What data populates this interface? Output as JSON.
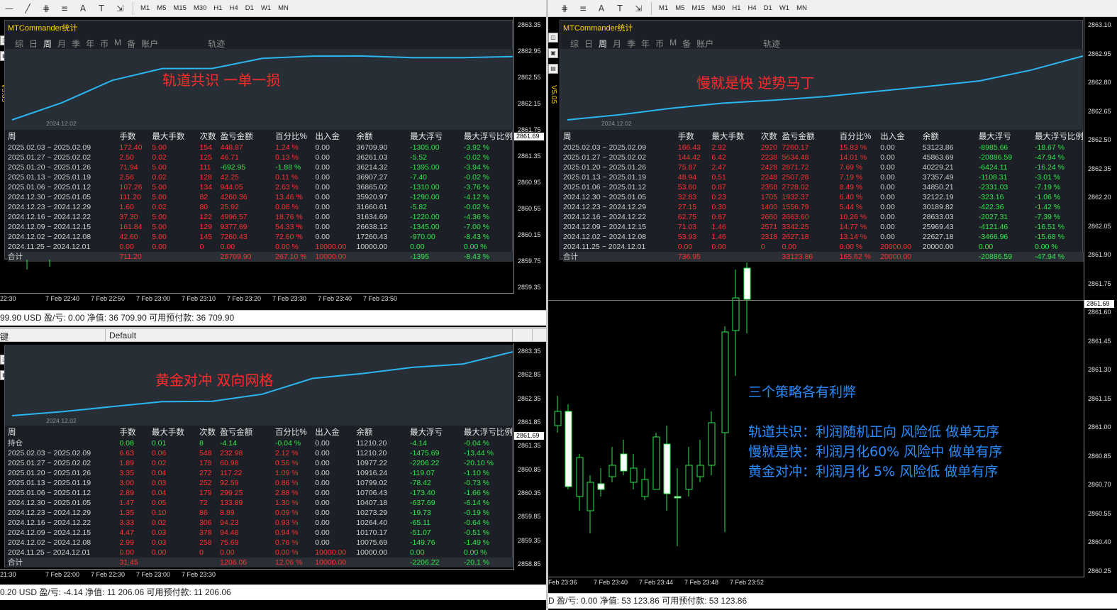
{
  "toolbar": {
    "timeframes": [
      "M1",
      "M5",
      "M15",
      "M30",
      "H1",
      "H4",
      "D1",
      "W1",
      "MN"
    ]
  },
  "stats_common": {
    "title": "MTCommander统计",
    "tabs": [
      "综",
      "日",
      "周",
      "月",
      "季",
      "年",
      "币",
      "M",
      "备",
      "账户"
    ],
    "active_tab": "周",
    "track_tab": "轨迹",
    "curve_date": "2024.12.02",
    "headers": [
      "周",
      "手数",
      "最大手数",
      "次数",
      "盈亏金额",
      "百分比%",
      "出入金",
      "余额",
      "最大浮亏",
      "最大浮亏比例"
    ]
  },
  "panel_tl": {
    "overlay_title": "轨道共识 一单一损",
    "vertical_label": "V5.05",
    "rows": [
      [
        "2025.02.03 ~ 2025.02.09",
        "172.40",
        "5.00",
        "154",
        "448.87",
        "1.24 %",
        "0.00",
        "36709.90",
        "-1305.00",
        "-3.92 %"
      ],
      [
        "2025.01.27 ~ 2025.02.02",
        "2.50",
        "0.02",
        "125",
        "46.71",
        "0.13 %",
        "0.00",
        "36261.03",
        "-5.52",
        "-0.02 %"
      ],
      [
        "2025.01.20 ~ 2025.01.26",
        "71.94",
        "5.00",
        "111",
        "-692.95",
        "-1.88 %",
        "0.00",
        "36214.32",
        "-1395.00",
        "-3.94 %"
      ],
      [
        "2025.01.13 ~ 2025.01.19",
        "2.56",
        "0.02",
        "128",
        "42.25",
        "0.11 %",
        "0.00",
        "36907.27",
        "-7.40",
        "-0.02 %"
      ],
      [
        "2025.01.06 ~ 2025.01.12",
        "107.26",
        "5.00",
        "134",
        "944.05",
        "2.63 %",
        "0.00",
        "36865.02",
        "-1310.00",
        "-3.76 %"
      ],
      [
        "2024.12.30 ~ 2025.01.05",
        "111.20",
        "5.00",
        "82",
        "4260.36",
        "13.46 %",
        "0.00",
        "35920.97",
        "-1290.00",
        "-4.12 %"
      ],
      [
        "2024.12.23 ~ 2024.12.29",
        "1.60",
        "0.02",
        "80",
        "25.92",
        "0.08 %",
        "0.00",
        "31660.61",
        "-5.82",
        "-0.02 %"
      ],
      [
        "2024.12.16 ~ 2024.12.22",
        "37.30",
        "5.00",
        "122",
        "4996.57",
        "18.76 %",
        "0.00",
        "31634.69",
        "-1220.00",
        "-4.36 %"
      ],
      [
        "2024.12.09 ~ 2024.12.15",
        "161.84",
        "5.00",
        "129",
        "9377.69",
        "54.33 %",
        "0.00",
        "26638.12",
        "-1345.00",
        "-7.00 %"
      ],
      [
        "2024.12.02 ~ 2024.12.08",
        "42.60",
        "5.00",
        "145",
        "7260.43",
        "72.60 %",
        "0.00",
        "17260.43",
        "-970.00",
        "-8.43 %"
      ],
      [
        "2024.11.25 ~ 2024.12.01",
        "0.00",
        "0.00",
        "0",
        "0.00",
        "0.00 %",
        "10000.00",
        "10000.00",
        "0.00",
        "0.00 %"
      ]
    ],
    "total": [
      "合计",
      "711.20",
      "",
      "",
      "26709.90",
      "267.10 %",
      "10000.00",
      "",
      "-1395",
      "-8.43 %"
    ],
    "prices": [
      "2863.35",
      "2862.95",
      "2862.55",
      "2862.15",
      "2861.75",
      "2861.35",
      "2860.95",
      "2860.55",
      "2860.15",
      "2859.75",
      "2859.35"
    ],
    "price_tag": "2861.69",
    "times": [
      "22:30",
      "7 Feb 22:40",
      "7 Feb 22:50",
      "7 Feb 23:00",
      "7 Feb 23:10",
      "7 Feb 23:20",
      "7 Feb 23:30",
      "7 Feb 23:40",
      "7 Feb 23:50"
    ],
    "account": "99.90 USD  盈/亏: 0.00  净值: 36 709.90  可用预付款: 36 709.90"
  },
  "panel_bl": {
    "header_left": "键",
    "header_default": "Default",
    "overlay_title": "黄金对冲 双向网格",
    "holding": [
      "持仓",
      "0.08",
      "0.01",
      "8",
      "-4.14",
      "-0.04 %",
      "0.00",
      "11210.20",
      "-4.14",
      "-0.04 %"
    ],
    "rows": [
      [
        "2025.02.03 ~ 2025.02.09",
        "6.63",
        "0.06",
        "548",
        "232.98",
        "2.12 %",
        "0.00",
        "11210.20",
        "-1475.69",
        "-13.44 %"
      ],
      [
        "2025.01.27 ~ 2025.02.02",
        "1.89",
        "0.02",
        "178",
        "60.98",
        "0.56 %",
        "0.00",
        "10977.22",
        "-2206.22",
        "-20.10 %"
      ],
      [
        "2025.01.20 ~ 2025.01.26",
        "3.35",
        "0.04",
        "272",
        "117.22",
        "1.09 %",
        "0.00",
        "10916.24",
        "-119.07",
        "-1.10 %"
      ],
      [
        "2025.01.13 ~ 2025.01.19",
        "3.00",
        "0.03",
        "252",
        "92.59",
        "0.86 %",
        "0.00",
        "10799.02",
        "-78.42",
        "-0.73 %"
      ],
      [
        "2025.01.06 ~ 2025.01.12",
        "2.89",
        "0.04",
        "179",
        "299.25",
        "2.88 %",
        "0.00",
        "10706.43",
        "-173.40",
        "-1.66 %"
      ],
      [
        "2024.12.30 ~ 2025.01.05",
        "1.47",
        "0.05",
        "72",
        "133.89",
        "1.30 %",
        "0.00",
        "10407.18",
        "-637.69",
        "-6.14 %"
      ],
      [
        "2024.12.23 ~ 2024.12.29",
        "1.35",
        "0.10",
        "86",
        "8.89",
        "0.09 %",
        "0.00",
        "10273.29",
        "-19.73",
        "-0.19 %"
      ],
      [
        "2024.12.16 ~ 2024.12.22",
        "3.33",
        "0.02",
        "306",
        "94.23",
        "0.93 %",
        "0.00",
        "10264.40",
        "-65.11",
        "-0.64 %"
      ],
      [
        "2024.12.09 ~ 2024.12.15",
        "4.47",
        "0.03",
        "378",
        "94.48",
        "0.94 %",
        "0.00",
        "10170.17",
        "-51.07",
        "-0.51 %"
      ],
      [
        "2024.12.02 ~ 2024.12.08",
        "2.99",
        "0.03",
        "258",
        "75.69",
        "0.76 %",
        "0.00",
        "10075.69",
        "-149.76",
        "-1.49 %"
      ],
      [
        "2024.11.25 ~ 2024.12.01",
        "0.00",
        "0.00",
        "0",
        "0.00",
        "0.00 %",
        "10000.00",
        "10000.00",
        "0.00",
        "0.00 %"
      ]
    ],
    "total": [
      "合计",
      "31.45",
      "",
      "",
      "1206.06",
      "12.06 %",
      "10000.00",
      "",
      "-2206.22",
      "-20.1 %"
    ],
    "prices": [
      "2863.35",
      "2862.85",
      "2862.35",
      "2861.85",
      "2861.35",
      "2860.85",
      "2860.35",
      "2859.85",
      "2859.35",
      "2858.85"
    ],
    "price_tag": "2861.69",
    "times": [
      "21:30",
      "7 Feb 22:00",
      "7 Feb 22:30",
      "7 Feb 23:00",
      "7 Feb 23:30"
    ],
    "account": "0.20 USD  盈/亏: -4.14  净值: 11 206.06  可用预付款: 11 206.06"
  },
  "panel_r": {
    "overlay_title": "慢就是快  逆势马丁",
    "vertical_label": "V5.05",
    "rows": [
      [
        "2025.02.03 ~ 2025.02.09",
        "166.43",
        "2.92",
        "2920",
        "7260.17",
        "15.83 %",
        "0.00",
        "53123.86",
        "-8985.66",
        "-18.67 %"
      ],
      [
        "2025.01.27 ~ 2025.02.02",
        "144.42",
        "6.42",
        "2238",
        "5634.48",
        "14.01 %",
        "0.00",
        "45863.69",
        "-20886.59",
        "-47.94 %"
      ],
      [
        "2025.01.20 ~ 2025.01.26",
        "75.87",
        "2.47",
        "2428",
        "2871.72",
        "7.69 %",
        "0.00",
        "40229.21",
        "-6424.11",
        "-16.24 %"
      ],
      [
        "2025.01.13 ~ 2025.01.19",
        "48.94",
        "0.51",
        "2248",
        "2507.28",
        "7.19 %",
        "0.00",
        "37357.49",
        "-1108.31",
        "-3.01 %"
      ],
      [
        "2025.01.06 ~ 2025.01.12",
        "53.60",
        "0.87",
        "2358",
        "2728.02",
        "8.49 %",
        "0.00",
        "34850.21",
        "-2331.03",
        "-7.19 %"
      ],
      [
        "2024.12.30 ~ 2025.01.05",
        "32.83",
        "0.23",
        "1705",
        "1932.37",
        "6.40 %",
        "0.00",
        "32122.19",
        "-323.16",
        "-1.06 %"
      ],
      [
        "2024.12.23 ~ 2024.12.29",
        "27.15",
        "0.30",
        "1400",
        "1556.79",
        "5.44 %",
        "0.00",
        "30189.82",
        "-422.36",
        "-1.42 %"
      ],
      [
        "2024.12.16 ~ 2024.12.22",
        "62.75",
        "0.87",
        "2660",
        "2663.60",
        "10.26 %",
        "0.00",
        "28633.03",
        "-2027.31",
        "-7.39 %"
      ],
      [
        "2024.12.09 ~ 2024.12.15",
        "71.03",
        "1.46",
        "2571",
        "3342.25",
        "14.77 %",
        "0.00",
        "25969.43",
        "-4121.46",
        "-16.51 %"
      ],
      [
        "2024.12.02 ~ 2024.12.08",
        "53.93",
        "1.46",
        "2318",
        "2627.18",
        "13.14 %",
        "0.00",
        "22627.18",
        "-3466.96",
        "-15.68 %"
      ],
      [
        "2024.11.25 ~ 2024.12.01",
        "0.00",
        "0.00",
        "0",
        "0.00",
        "0.00 %",
        "20000.00",
        "20000.00",
        "0.00",
        "0.00 %"
      ]
    ],
    "total": [
      "合计",
      "736.95",
      "",
      "",
      "33123.86",
      "165.62 %",
      "20000.00",
      "",
      "-20886.59",
      "-47.94 %"
    ],
    "prices": [
      "2863.10",
      "2862.95",
      "2862.80",
      "2862.65",
      "2862.50",
      "2862.35",
      "2862.20",
      "2862.05",
      "2861.90",
      "2861.75",
      "2861.60",
      "2861.45",
      "2861.30",
      "2861.15",
      "2861.00",
      "2860.85",
      "2860.70",
      "2860.55",
      "2860.40",
      "2860.25"
    ],
    "price_tag": "2861.69",
    "times": [
      "Feb 23:36",
      "7 Feb 23:40",
      "7 Feb 23:44",
      "7 Feb 23:48",
      "7 Feb 23:52"
    ],
    "account": "D  盈/亏: 0.00  净值: 53 123.86  可用预付款: 53 123.86",
    "notes": [
      "三个策略各有利弊",
      "轨道共识：利润随机正向 风险低  做单无序",
      "慢就是快：利润月化60% 风险中  做单有序",
      "黄金对冲：利润月化 5%  风险低  做单有序"
    ]
  },
  "colors": {
    "curve": "#2ab6f0",
    "title_yellow": "#ffd400",
    "red": "#ff3030",
    "green": "#2ee84a",
    "note_blue": "#2a8cff",
    "candle_up": "#2ee84a",
    "candle_body": "#ffffff"
  }
}
